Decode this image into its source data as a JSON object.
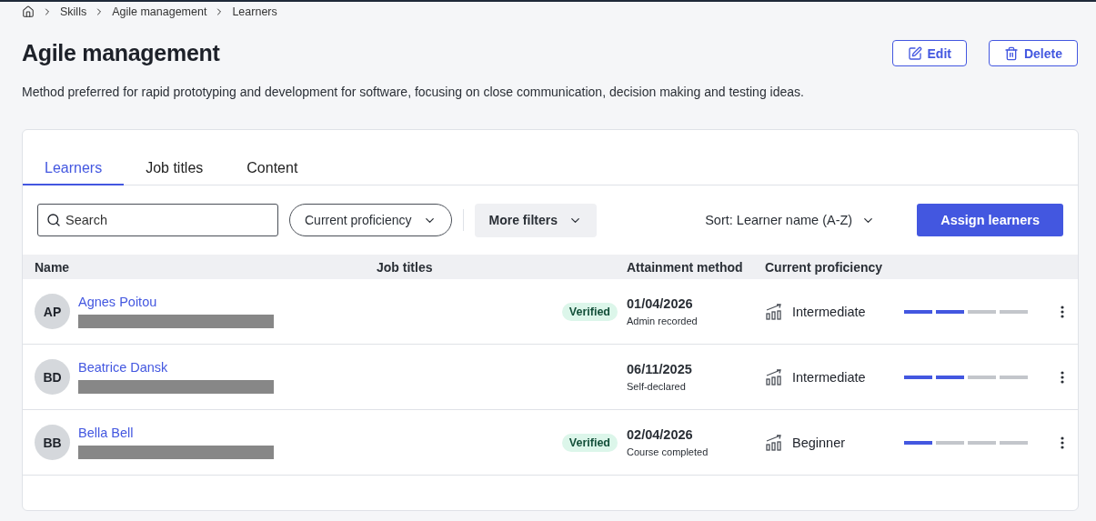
{
  "breadcrumbs": [
    "Skills",
    "Agile management",
    "Learners"
  ],
  "title": "Agile management",
  "actions": [
    {
      "kind": "edit",
      "label": "Edit"
    },
    {
      "kind": "delete",
      "label": "Delete"
    }
  ],
  "description": "Method preferred for rapid prototyping and development for software, focusing on close communication, decision making and testing ideas.",
  "tabs": [
    {
      "label": "Learners",
      "selected": true
    },
    {
      "label": "Job titles",
      "selected": false
    },
    {
      "label": "Content",
      "selected": false
    }
  ],
  "search": {
    "placeholder": "Search"
  },
  "filters": [
    {
      "kind": "outline",
      "label": "Current proficiency"
    },
    {
      "kind": "filled",
      "label": "More filters"
    }
  ],
  "sort": "Sort: Learner name (A-Z)",
  "primary_button": "Assign learners",
  "table": {
    "columns": [
      "Name",
      "Job titles",
      "Attainment method",
      "Current proficiency"
    ],
    "rows": [
      {
        "initials": "AP",
        "name": "Agnes Poitou",
        "badge": "Verified",
        "date": "01/04/2026",
        "method": "Admin recorded",
        "proficiency": "Intermediate",
        "level": 0.5
      },
      {
        "initials": "BD",
        "name": "Beatrice Dansk",
        "date": "06/11/2025",
        "method": "Self-declared",
        "proficiency": "Intermediate",
        "level": 0.5
      },
      {
        "initials": "BB",
        "name": "Bella Bell",
        "badge": "Verified",
        "date": "02/04/2026",
        "method": "Course completed",
        "proficiency": "Beginner",
        "level": 0.25
      }
    ]
  }
}
